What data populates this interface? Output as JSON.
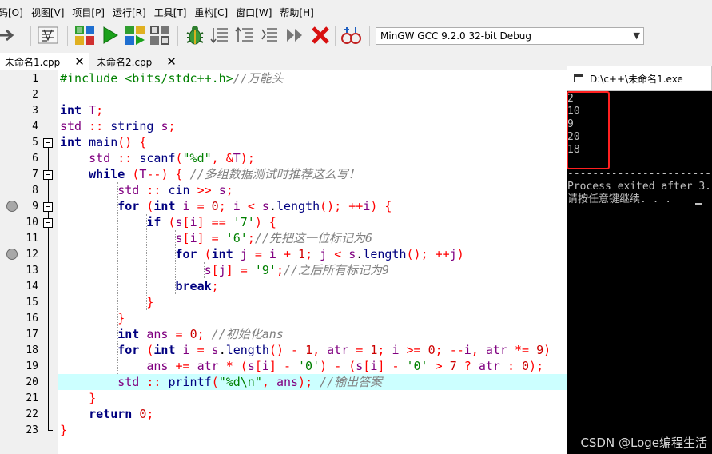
{
  "menu": {
    "items": [
      "代码[O]",
      "视图[V]",
      "项目[P]",
      "运行[R]",
      "工具[T]",
      "重构[C]",
      "窗口[W]",
      "帮助[H]"
    ]
  },
  "toolbar": {
    "compiler": "MinGW GCC 9.2.0 32-bit Debug",
    "icons": [
      "undo-arrow-icon",
      "redo-arrow-icon",
      "format-code-icon",
      "compile-icon",
      "run-icon",
      "compile-run-icon",
      "rebuild-icon",
      "debug-icon",
      "indent-icon",
      "unindent-icon",
      "toggle-comment-icon",
      "step-icon",
      "stop-icon",
      "profile-icon"
    ]
  },
  "tabs": [
    {
      "label": "未命名1.cpp",
      "close": "✕"
    },
    {
      "label": "未命名2.cpp",
      "close": "✕"
    }
  ],
  "editor": {
    "line_numbers": [
      "1",
      "2",
      "3",
      "4",
      "5",
      "6",
      "7",
      "8",
      "9",
      "10",
      "11",
      "12",
      "13",
      "14",
      "15",
      "16",
      "17",
      "18",
      "19",
      "20",
      "21",
      "22",
      "23"
    ],
    "breakpoint_lines": [
      9,
      12
    ],
    "highlighted_line": 20,
    "code": [
      "#include <bits/stdc++.h>//万能头",
      "",
      "int T;",
      "std :: string s;",
      "int main() {",
      "    std :: scanf(\"%d\", &T);",
      "    while (T--) { //多组数据测试时推荐这么写！",
      "        std :: cin >> s;",
      "        for (int i = 0; i < s.length(); ++i) {",
      "            if (s[i] == '7') {",
      "                s[i] = '6';//先把这一位标记为6",
      "                for (int j = i + 1; j < s.length(); ++j)",
      "                    s[j] = '9';//之后所有标记为9",
      "                break;",
      "            }",
      "        }",
      "        int ans = 0; //初始化ans",
      "        for (int i = s.length() - 1, atr = 1; i >= 0; --i, atr *= 9)",
      "            ans += atr * (s[i] - '0') - (s[i] - '0' > 7 ? atr : 0);",
      "        std :: printf(\"%d\\n\", ans); //输出答案",
      "    }",
      "    return 0;",
      "}"
    ]
  },
  "console": {
    "title": "D:\\c++\\未命名1.exe",
    "output_lines": [
      "2",
      "10",
      "9",
      "20",
      "18"
    ],
    "separator": "--------------------------------",
    "process_line": "Process exited after 3.",
    "prompt_line": "请按任意键继续. . .",
    "watermark": "CSDN @Loge编程生活"
  },
  "colors": {
    "keyword": "#00007f",
    "string": "#008000",
    "number": "#cc0000",
    "operator": "#ff0000",
    "comment": "#808080",
    "current_line": "#ccffff",
    "annotation_box": "#ff2020"
  }
}
